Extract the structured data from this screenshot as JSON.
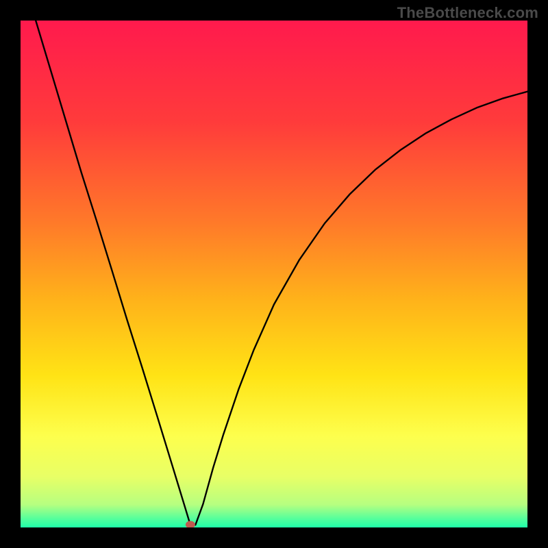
{
  "watermark": "TheBottleneck.com",
  "chart_data": {
    "type": "line",
    "title": "",
    "xlabel": "",
    "ylabel": "",
    "xlim": [
      0,
      100
    ],
    "ylim": [
      0,
      100
    ],
    "grid": false,
    "legend": false,
    "marker": {
      "x": 33.5,
      "y": 0,
      "color": "#c05a50",
      "note": "red dot at curve minimum"
    },
    "series": [
      {
        "name": "bottleneck-curve",
        "x": [
          3,
          6,
          9,
          12,
          15,
          18,
          21,
          24,
          27,
          30,
          32.5,
          33.5,
          34.5,
          36,
          38,
          40,
          43,
          46,
          50,
          55,
          60,
          65,
          70,
          75,
          80,
          85,
          90,
          95,
          100
        ],
        "y": [
          100,
          90,
          80,
          70,
          60.5,
          50.8,
          41,
          31.5,
          21.8,
          12,
          3.8,
          0.5,
          0.5,
          4.6,
          11.8,
          18.3,
          27.2,
          35,
          44,
          52.8,
          60,
          65.8,
          70.6,
          74.5,
          77.8,
          80.5,
          82.8,
          84.6,
          86
        ]
      }
    ],
    "background_gradient": {
      "orientation": "vertical",
      "stops": [
        {
          "offset": 0.0,
          "color": "#ff1a4d"
        },
        {
          "offset": 0.2,
          "color": "#ff3b3b"
        },
        {
          "offset": 0.4,
          "color": "#ff7a29"
        },
        {
          "offset": 0.55,
          "color": "#ffb21a"
        },
        {
          "offset": 0.7,
          "color": "#ffe315"
        },
        {
          "offset": 0.82,
          "color": "#fdff4d"
        },
        {
          "offset": 0.9,
          "color": "#e8ff66"
        },
        {
          "offset": 0.955,
          "color": "#b6ff80"
        },
        {
          "offset": 0.985,
          "color": "#4dff9e"
        },
        {
          "offset": 1.0,
          "color": "#1fffa8"
        }
      ]
    }
  }
}
